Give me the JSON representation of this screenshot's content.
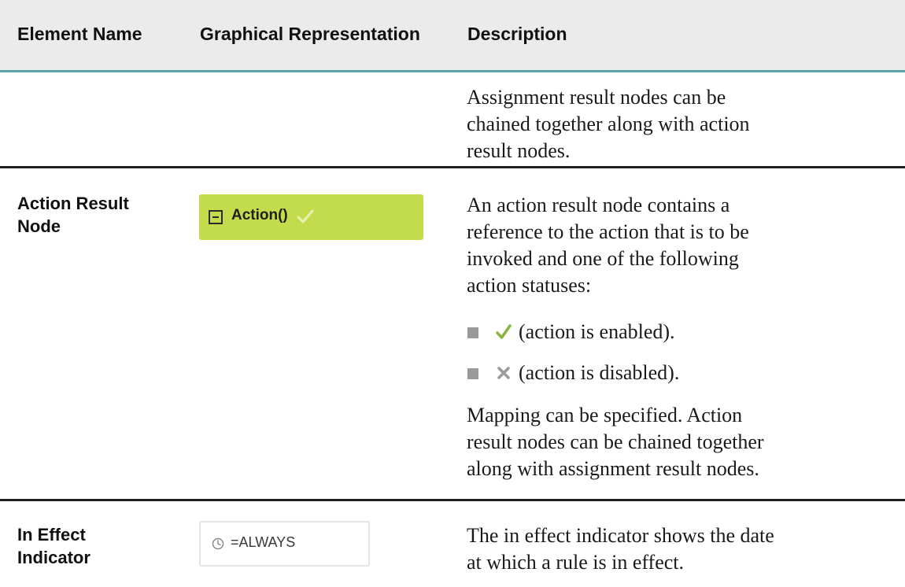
{
  "header": {
    "col1": "Element Name",
    "col2": "Graphical Representation",
    "col3": "Description"
  },
  "rows": [
    {
      "description": [
        "Assignment result nodes can be chained together along with action result nodes."
      ]
    },
    {
      "name": [
        "Action Result",
        "Node"
      ],
      "graphic_label": "Action()",
      "graphic_icon": "check-icon",
      "graphic_color": "#c2dc4b",
      "intro": [
        "An action result node contains a",
        "reference to the action that is to be",
        "invoked and one of the following",
        "action statuses:"
      ],
      "bullets": [
        {
          "icon": "green-check-icon",
          "text": "(action is enabled)."
        },
        {
          "icon": "gray-x-icon",
          "text": "(action is disabled)."
        }
      ],
      "outro": [
        "Mapping can be specified. Action",
        "result nodes can be chained together",
        "along with assignment result nodes."
      ]
    },
    {
      "name": [
        "In Effect",
        "Indicator"
      ],
      "graphic_label": "=ALWAYS",
      "graphic_icon": "clock-icon",
      "description": [
        "The in effect indicator shows the date",
        "at which a rule is in effect."
      ]
    }
  ]
}
